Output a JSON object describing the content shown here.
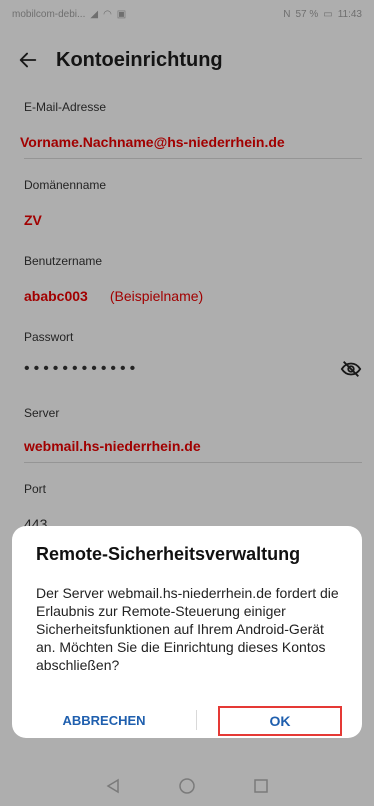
{
  "status_bar": {
    "left_text": "mobilcom-debi...",
    "right_text": "57 %",
    "time": "11:43"
  },
  "app_bar": {
    "title": "Kontoeinrichtung",
    "back_icon": "arrow-left-icon"
  },
  "fields": [
    {
      "label": "E-Mail-Adresse",
      "value": "Vorname.Nachname@hs-niederrhein.de"
    },
    {
      "label": "Domänenname",
      "value": "ZV"
    },
    {
      "label": "Benutzername",
      "value": "ababc003",
      "hint": "(Beispielname)"
    },
    {
      "label": "Passwort",
      "value": "••••••••••••",
      "icon": "eye-off-icon"
    },
    {
      "label": "Server",
      "value": "webmail.hs-niederrhein.de"
    },
    {
      "label": "Port",
      "value": "443"
    }
  ],
  "dialog": {
    "title": "Remote-Sicherheitsverwaltung",
    "message": "Der Server webmail.hs-niederrhein.de fordert die Erlaubnis zur Remote-Steuerung einiger Sicherheitsfunktionen auf Ihrem Android-Gerät an. Möchten Sie die Einrichtung dieses Kontos abschließen?",
    "cancel_label": "ABBRECHEN",
    "ok_label": "OK"
  },
  "colors": {
    "highlight_text": "#e00000",
    "button_text": "#1f5fae",
    "highlight_border": "#e53935"
  }
}
